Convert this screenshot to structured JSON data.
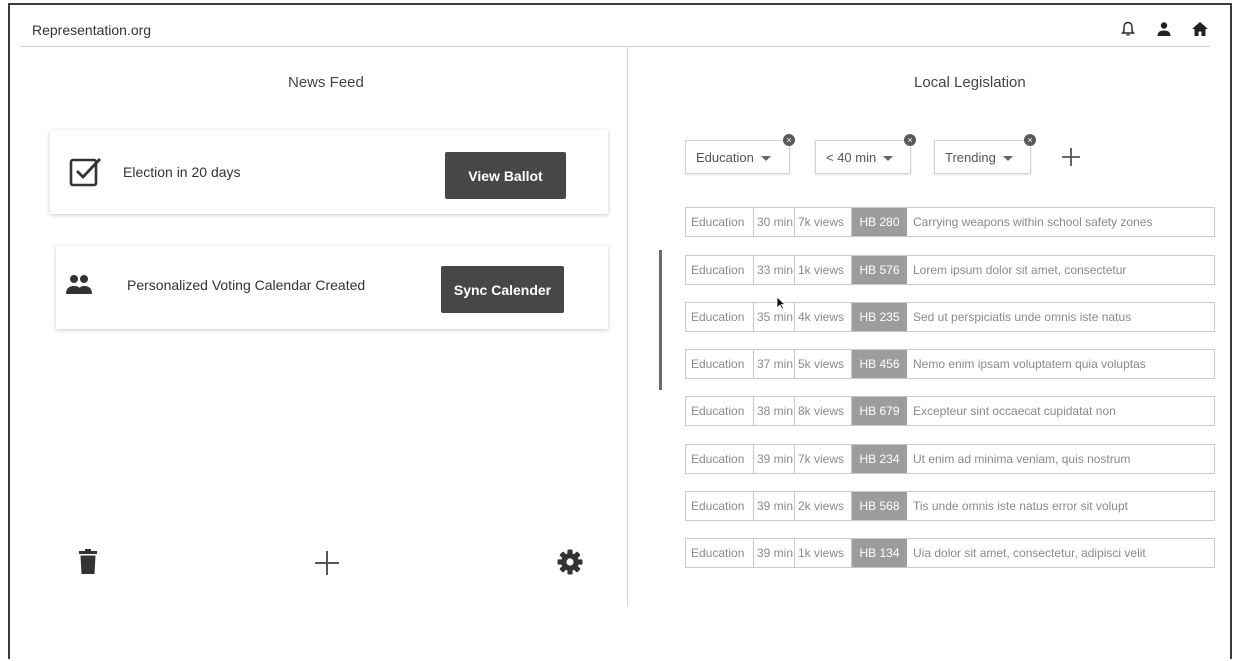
{
  "header": {
    "brand": "Representation.org",
    "icons": [
      "bell-icon",
      "person-icon",
      "home-icon"
    ]
  },
  "news_feed": {
    "title": "News Feed",
    "cards": [
      {
        "icon": "checkbox-icon",
        "text": "Election in 20 days",
        "button": "View Ballot"
      },
      {
        "icon": "people-icon",
        "text": "Personalized Voting Calendar Created",
        "button": "Sync Calender"
      }
    ],
    "bottom_icons": [
      "trash-icon",
      "plus-icon",
      "gear-icon"
    ]
  },
  "legislation": {
    "title": "Local Legislation",
    "filters": [
      {
        "label": "Education"
      },
      {
        "label": "< 40 min"
      },
      {
        "label": "Trending"
      }
    ],
    "add_filter_icon": "plus-icon",
    "rows": [
      {
        "category": "Education",
        "time": "30 min",
        "views": "7k views",
        "bill": "HB 280",
        "title": "Carrying weapons within school safety zones"
      },
      {
        "category": "Education",
        "time": "33 min",
        "views": "1k views",
        "bill": "HB 576",
        "title": "Lorem ipsum dolor sit amet, consectetur"
      },
      {
        "category": "Education",
        "time": "35 min",
        "views": "4k views",
        "bill": "HB 235",
        "title": "Sed ut perspiciatis unde omnis iste natus"
      },
      {
        "category": "Education",
        "time": "37 min",
        "views": "5k views",
        "bill": "HB 456",
        "title": "Nemo enim ipsam voluptatem quia voluptas"
      },
      {
        "category": "Education",
        "time": "38 min",
        "views": "8k views",
        "bill": "HB 679",
        "title": "Excepteur sint occaecat cupidatat non"
      },
      {
        "category": "Education",
        "time": "39 min",
        "views": "7k views",
        "bill": "HB 234",
        "title": "Ut enim ad minima veniam, quis nostrum"
      },
      {
        "category": "Education",
        "time": "39 min",
        "views": "2k views",
        "bill": "HB 568",
        "title": "Tis unde omnis iste natus error sit volupt"
      },
      {
        "category": "Education",
        "time": "39 min",
        "views": "1k views",
        "bill": "HB 134",
        "title": "Uia dolor sit amet, consectetur, adipisci velit"
      }
    ]
  },
  "colors": {
    "button": "#474747",
    "bill_tag": "#9c9c9c"
  }
}
